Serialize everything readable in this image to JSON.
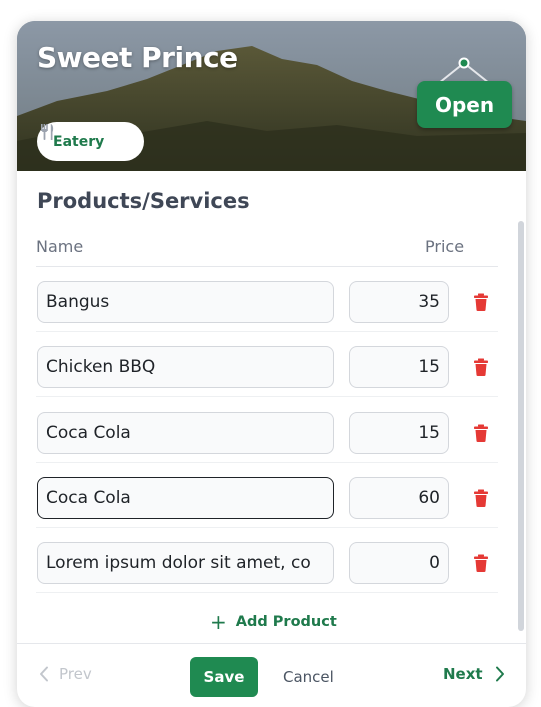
{
  "business": {
    "name": "Sweet Prince",
    "category": "Eatery",
    "category_icon": "utensils-icon",
    "status_sign": "Open"
  },
  "products": {
    "title": "Products/Services",
    "columns": {
      "name": "Name",
      "price": "Price"
    },
    "items": [
      {
        "name": "Bangus",
        "price": "35"
      },
      {
        "name": "Chicken BBQ",
        "price": "15"
      },
      {
        "name": "Coca Cola",
        "price": "15"
      },
      {
        "name": "Coca Cola",
        "price": "60"
      },
      {
        "name": "Lorem ipsum dolor sit amet, co",
        "price": "0"
      }
    ],
    "add_label": "Add Product"
  },
  "footer": {
    "prev_label": "Prev",
    "save_label": "Save",
    "cancel_label": "Cancel",
    "next_label": "Next"
  },
  "colors": {
    "accent": "#1f8a51",
    "delete": "#e53935",
    "disabled": "#c2c6cc"
  }
}
